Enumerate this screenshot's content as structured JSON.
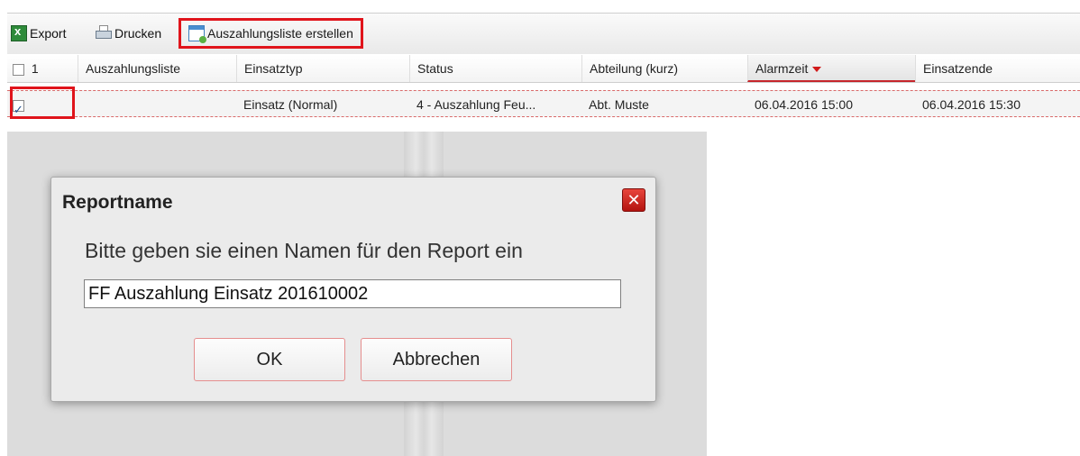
{
  "toolbar": {
    "export_label": "Export",
    "print_label": "Drucken",
    "create_label": "Auszahlungsliste erstellen"
  },
  "grid": {
    "select_count": "1",
    "columns": [
      "Auszahlungsliste",
      "Einsatztyp",
      "Status",
      "Abteilung (kurz)",
      "Alarmzeit",
      "Einsatzende"
    ],
    "sorted_column": "Alarmzeit",
    "sort_direction": "descending",
    "rows": [
      {
        "selected": true,
        "auszahlungsliste": "",
        "einsatztyp": "Einsatz (Normal)",
        "status": "4 - Auszahlung Feu...",
        "abteilung": "Abt. Muste",
        "alarmzeit": "06.04.2016 15:00",
        "einsatzende": "06.04.2016 15:30"
      }
    ]
  },
  "dialog": {
    "title": "Reportname",
    "message": "Bitte geben sie einen Namen für den Report ein",
    "input_value": "FF Auszahlung Einsatz 201610002",
    "ok_label": "OK",
    "cancel_label": "Abbrechen",
    "close_icon": "close-icon"
  },
  "colors": {
    "highlight": "#e0141b",
    "close_button": "#c9211b",
    "sort_arrow": "#d11a1a"
  }
}
